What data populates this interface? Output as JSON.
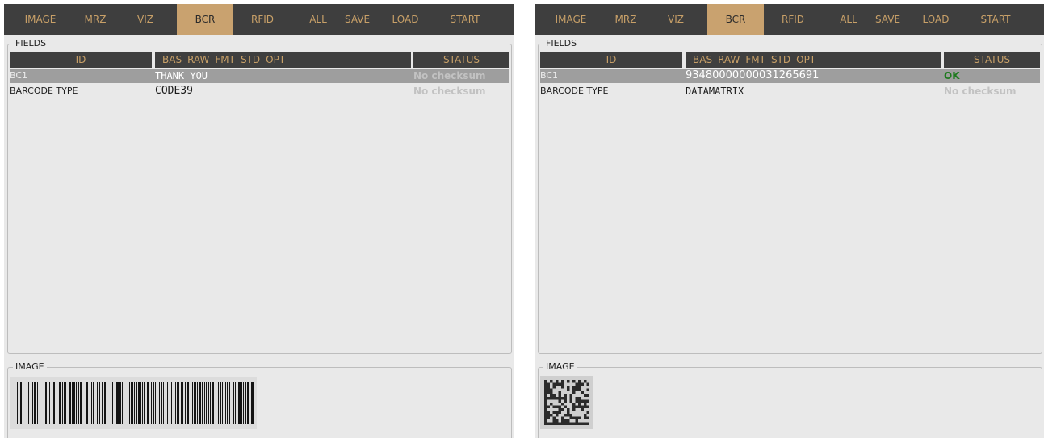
{
  "colors": {
    "ok": "#1e7a1e",
    "no_checksum": "#c2c2c2"
  },
  "panels": [
    {
      "tabs": [
        "IMAGE",
        "MRZ",
        "VIZ",
        "BCR",
        "RFID",
        "ALL",
        "SAVE",
        "LOAD",
        "START"
      ],
      "active_tab": "BCR",
      "fields_label": "FIELDS",
      "columns": {
        "id": "ID",
        "formats": [
          "BAS",
          "RAW",
          "FMT",
          "STD",
          "OPT"
        ],
        "status": "STATUS"
      },
      "rows": [
        {
          "id": "BC1",
          "value": "THANK YOU",
          "status": "No checksum",
          "status_color": "#c2c2c2"
        },
        {
          "id": "BARCODE TYPE",
          "value": "CODE39",
          "status": "No checksum",
          "status_color": "#c2c2c2"
        }
      ],
      "image_label": "IMAGE",
      "image_kind": "linear-barcode"
    },
    {
      "tabs": [
        "IMAGE",
        "MRZ",
        "VIZ",
        "BCR",
        "RFID",
        "ALL",
        "SAVE",
        "LOAD",
        "START"
      ],
      "active_tab": "BCR",
      "fields_label": "FIELDS",
      "columns": {
        "id": "ID",
        "formats": [
          "BAS",
          "RAW",
          "FMT",
          "STD",
          "OPT"
        ],
        "status": "STATUS"
      },
      "rows": [
        {
          "id": "BC1",
          "value": "93480000000031265691",
          "status": "OK",
          "status_color": "#1e7a1e"
        },
        {
          "id": "BARCODE TYPE",
          "value": "DATAMATRIX",
          "status": "No checksum",
          "status_color": "#c2c2c2"
        }
      ],
      "image_label": "IMAGE",
      "image_kind": "datamatrix"
    }
  ]
}
